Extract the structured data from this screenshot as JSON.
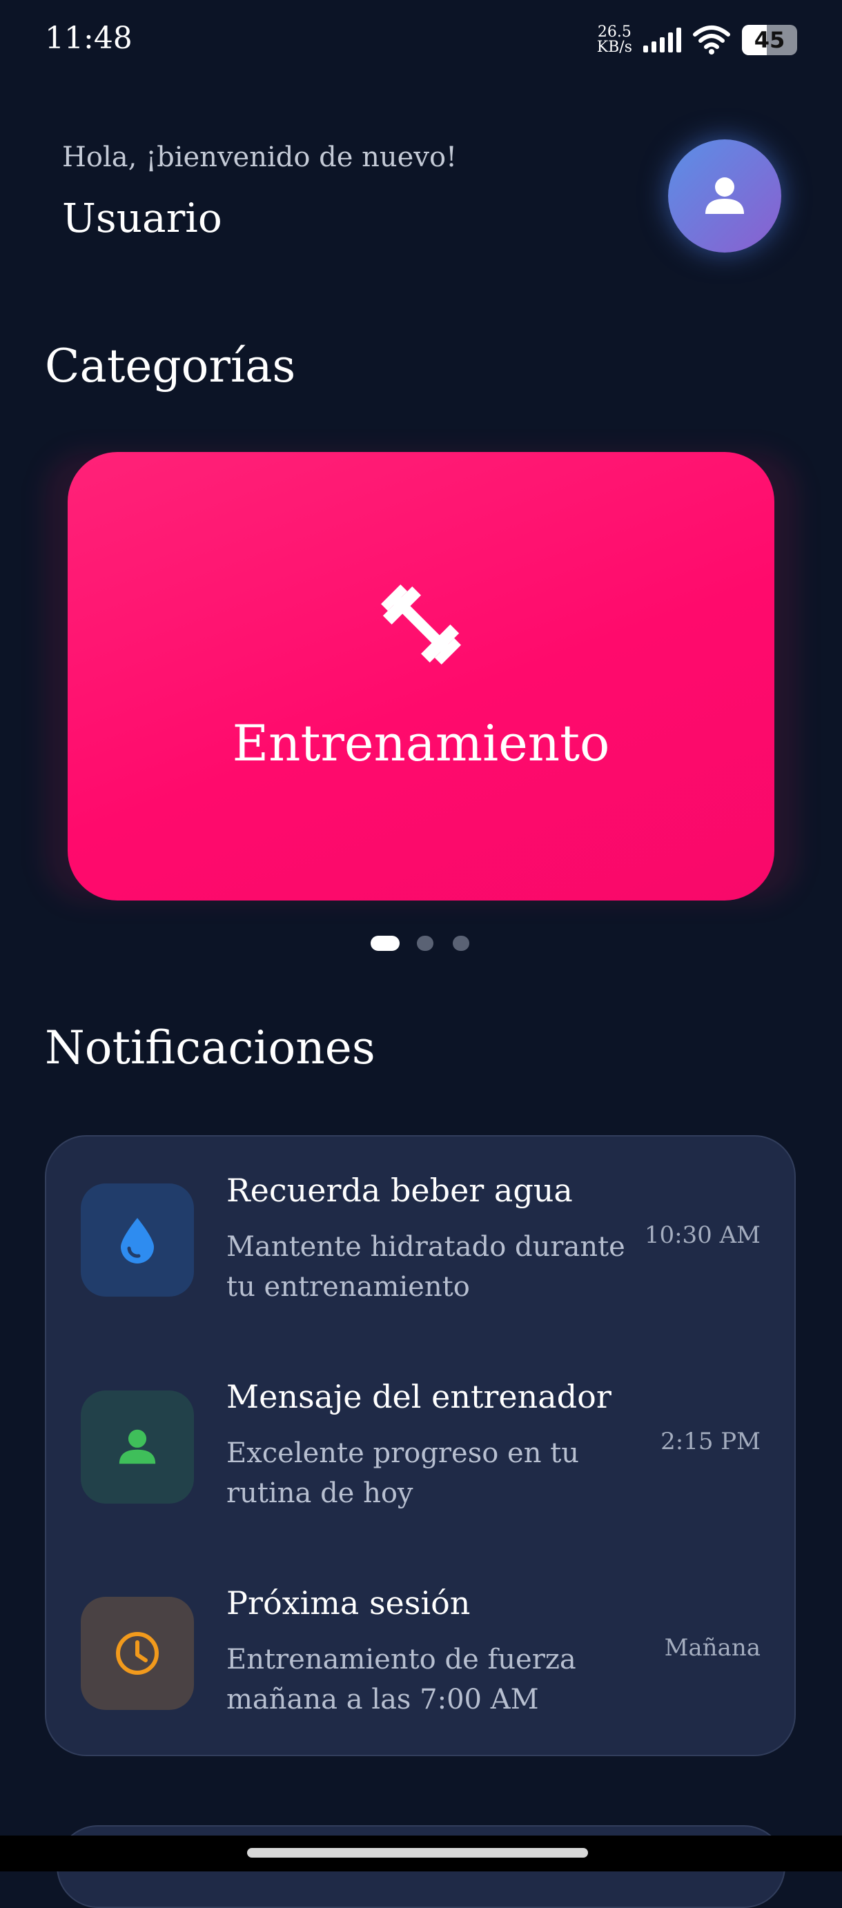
{
  "status_bar": {
    "time": "11:48",
    "net_speed_value": "26.5",
    "net_speed_unit": "KB/s",
    "battery": "45",
    "battery_level_percent": 45,
    "icons": [
      "signal-icon",
      "wifi-icon",
      "battery-icon"
    ]
  },
  "header": {
    "greeting": "Hola, ¡bienvenido de nuevo!",
    "username": "Usuario",
    "avatar_icon": "person-icon"
  },
  "categories": {
    "title": "Categorías",
    "active_card": {
      "label": "Entrenamiento",
      "icon": "dumbbell-icon",
      "color": "#ff0a6c"
    },
    "carousel_pages": 3,
    "active_page": 1
  },
  "notifications": {
    "title": "Notificaciones",
    "items": [
      {
        "title": "Recuerda beber agua",
        "description": "Mantente hidratado durante tu entrenamiento",
        "time": "10:30 AM",
        "icon": "water-drop-icon",
        "icon_color": "#2e8cf0",
        "icon_bg": "#213d6b"
      },
      {
        "title": "Mensaje del entrenador",
        "description": "Excelente progreso en tu rutina de hoy",
        "time": "2:15 PM",
        "icon": "person-icon",
        "icon_color": "#3fbf5a",
        "icon_bg": "#22414a"
      },
      {
        "title": "Próxima sesión",
        "description": "Entrenamiento de fuerza mañana a las 7:00 AM",
        "time": "Mañana",
        "icon": "clock-icon",
        "icon_color": "#f29a1c",
        "icon_bg": "#4a4244"
      }
    ]
  },
  "colors": {
    "background": "#0c1426",
    "card": "#1f2a47",
    "accent": "#ff0a6c"
  }
}
